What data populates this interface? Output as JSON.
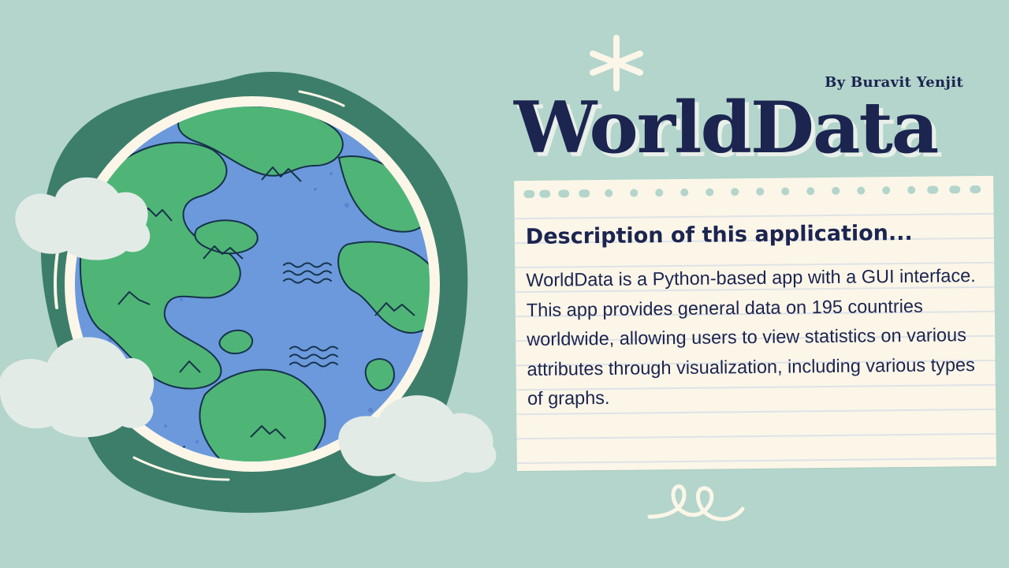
{
  "slide": {
    "author": "By Buravit Yenjit",
    "title": "WorldData",
    "note": {
      "heading": "Description of this application...",
      "body": "WorldData is a Python-based app with a GUI interface. This app provides general data on 195 countries worldwide, allowing users to view statistics on various attributes through visualization, including various types of graphs."
    }
  },
  "illustration": {
    "globe_icon": "earth-globe-icon",
    "cloud_icon": "cloud-icon",
    "sparkle_icon": "sparkle-icon",
    "swirl_icon": "swirl-doodle-icon"
  },
  "colors": {
    "background": "#b3d5cb",
    "blob": "#3d7e6b",
    "ocean": "#6b99dc",
    "land": "#4fb577",
    "cream": "#fbf6e8",
    "cloud": "#e3ebe6",
    "ink": "#1c2450"
  }
}
